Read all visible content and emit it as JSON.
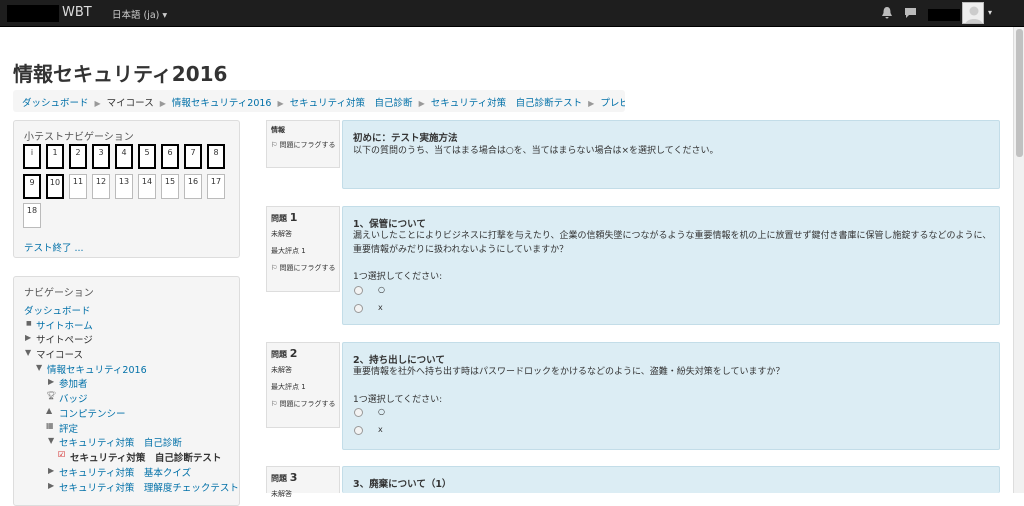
{
  "navbar": {
    "brand": "WBT",
    "language": "日本語 (ja) ▾",
    "caret": "▾"
  },
  "page": {
    "title": "情報セキュリティ2016"
  },
  "breadcrumb": [
    "ダッシュボード",
    "マイコース",
    "情報セキュリティ2016",
    "セキュリティ対策　自己診断",
    "セキュリティ対策　自己診断テスト",
    "プレビュー"
  ],
  "quiz_nav": {
    "title": "小テストナビゲーション",
    "buttons": [
      "i",
      "1",
      "2",
      "3",
      "4",
      "5",
      "6",
      "7",
      "8",
      "9",
      "10",
      "11",
      "12",
      "13",
      "14",
      "15",
      "16",
      "17",
      "18"
    ],
    "finish": "テスト終了 ..."
  },
  "navigation": {
    "title": "ナビゲーション",
    "dashboard": "ダッシュボード",
    "site_home": "サイトホーム",
    "site_pages": "サイトページ",
    "my_courses": "マイコース",
    "course": "情報セキュリティ2016",
    "participants": "参加者",
    "badges": "バッジ",
    "competencies": "コンピテンシー",
    "grades": "評定",
    "section1": "セキュリティ対策　自己診断",
    "current": "セキュリティ対策　自己診断テスト",
    "section2": "セキュリティ対策　基本クイズ",
    "section3": "セキュリティ対策　理解度チェックテスト"
  },
  "intro": {
    "label": "情報",
    "flag": "問題にフラグする",
    "heading": "初めに：テスト実施方法",
    "text": "以下の質問のうち、当てはまる場合は○を、当てはまらない場合は×を選択してください。"
  },
  "questions": [
    {
      "label": "問題",
      "number": "1",
      "status": "未解答",
      "max": "最大評点 1",
      "flag": "問題にフラグする",
      "heading": "1、保管について",
      "text": "漏えいしたことによりビジネスに打撃を与えたり、企業の信頼失墜につながるような重要情報を机の上に放置せず鍵付き書庫に保管し施錠するなどのように、重要情報がみだりに扱われないようにしていますか？",
      "select": "1つ選択してください:",
      "options": [
        "○",
        "x"
      ]
    },
    {
      "label": "問題",
      "number": "2",
      "status": "未解答",
      "max": "最大評点 1",
      "flag": "問題にフラグする",
      "heading": "2、持ち出しについて",
      "text": "重要情報を社外へ持ち出す時はパスワードロックをかけるなどのように、盗難・紛失対策をしていますか？",
      "select": "1つ選択してください:",
      "options": [
        "○",
        "x"
      ]
    },
    {
      "label": "問題",
      "number": "3",
      "status": "未解答",
      "heading": "3、廃棄について（1）"
    }
  ]
}
